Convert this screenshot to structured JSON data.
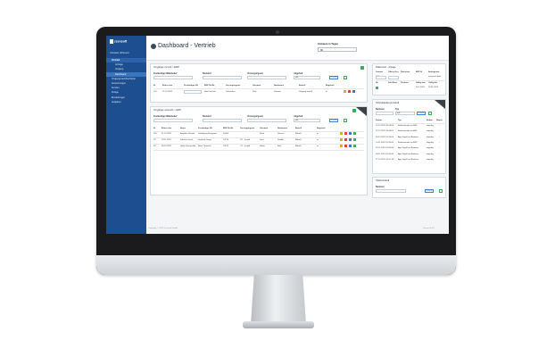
{
  "window": {
    "title": "Dashboard - Vertrieb"
  },
  "brand": {
    "name": "zsensoft",
    "logo_text": "zsensoft"
  },
  "user": {
    "label": "Christian Wittmann"
  },
  "sidebar": {
    "items": [
      {
        "label": "Vertrieb",
        "kind": "section"
      },
      {
        "label": "Anfrage",
        "kind": "sub"
      },
      {
        "label": "Vorgang",
        "kind": "sub"
      },
      {
        "label": "Dashboard",
        "kind": "sub",
        "active": true
      },
      {
        "label": "Vorgangssachbearbeiter",
        "kind": "item"
      },
      {
        "label": "Auswertungen",
        "kind": "item"
      },
      {
        "label": "Kunden",
        "kind": "item"
      },
      {
        "label": "Anlage",
        "kind": "item"
      },
      {
        "label": "Einstellungen",
        "kind": "item"
      },
      {
        "label": "Aufgaben",
        "kind": "item"
      }
    ]
  },
  "header": {
    "zeitraum_label": "Zeitraum in Tagen",
    "zeitraum_value": "30"
  },
  "panel1": {
    "title": "Vorgänge zurück > ERP",
    "filter_labels": [
      "Zuständiger Mitarbeiter",
      "Standort",
      "Vorsorgungsart",
      "Abgeholt"
    ],
    "filter_value": "alle",
    "filter_button": "Filtern",
    "columns": [
      "ID",
      "Erfasst am",
      "Zuständiger Mi.",
      "ERP-Nr./Nr.",
      "Vorsorgungsart",
      "Vorname",
      "Nachname",
      "Betreff",
      "Abgeholt"
    ],
    "rows": [
      [
        "170",
        "21.12.2022",
        "Ident Sachen",
        "Verkäufern",
        "Klee",
        "Schmitz",
        "Vorgang betreff",
        "ja"
      ]
    ]
  },
  "panel2": {
    "title": "Vorgänge versucht > ERP",
    "filter_labels": [
      "Zuständiger Mitarbeiter",
      "Standort",
      "Vorsorgungsart",
      "Abgeholt"
    ],
    "filter_value": "alle",
    "filter_button": "Filtern",
    "columns": [
      "ID",
      "Erfasst am",
      "Name",
      "Zuständiger Mi.",
      "ERP-Nr./Nr.",
      "Vorsorgungsart",
      "Vorname",
      "Nachname",
      "Betreff",
      "Abgeholt"
    ],
    "rows": [
      [
        "165",
        "21.12.2022",
        "Angelika Schmitt",
        "Vorfolgung Entegritter",
        "10455",
        "",
        "Karin",
        "Giersen",
        "Betreff",
        "ja"
      ],
      [
        "79",
        "19.11.2022",
        "Sabrina Jacob",
        "Stephan Lange",
        "14774",
        "CF - Installt",
        "Jens",
        "Stoffels",
        "Betreff",
        "ja"
      ],
      [
        "63",
        "08.12.2022",
        "Heike Sonnenfeld",
        "Rene Tonnelier",
        "13272",
        "OT - Installt",
        "Halter",
        "Bird",
        "Betreff",
        "ja"
      ]
    ]
  },
  "right_panel1": {
    "title": "Datensatz - Anlage",
    "columns": [
      "Gesamt",
      "Offene Ges.",
      "Datensatz",
      "ERP Id",
      "Anfragenart"
    ],
    "values": [
      "TSB",
      "",
      "",
      "",
      "ausgezeichnet"
    ],
    "columns2": [
      "Nr.",
      "Zeitl Best",
      "Zustand",
      "Gültig von",
      "Gültig bis"
    ],
    "values2": [
      "",
      "",
      "",
      "16.1.2023",
      "19.01.2023"
    ]
  },
  "right_panel2": {
    "title": "Schnittstellenprotokoll",
    "filter_labels": [
      "Nummer",
      "Typ"
    ],
    "filter_value": "alle",
    "filter_button": "Filtern",
    "columns": [
      "Datum",
      "Typ",
      "Aktion",
      "Status"
    ],
    "rows": [
      [
        "22.12.2022 10:08:03",
        "Bodenwunder an ERP",
        "abgeltig"
      ],
      [
        "22.12.2022 10:08:03",
        "Bodenwunder an ERP",
        "abgeltig"
      ],
      [
        "08.12.2022 10:36:03",
        "App Zugriff auf Bodenw.",
        "abgeltig"
      ],
      [
        "14.11.2022 10:33:06",
        "Bodenwunder an ERP",
        "abgeltig"
      ],
      [
        "13.11.2022 10:33:06",
        "App Zugriff auf Bodenw.",
        "abgeltig"
      ],
      [
        "08.11.2022 10:33:06",
        "App Zugriff auf Bodenw.",
        "abgeltig"
      ],
      [
        "27.10.2022 10:01:13",
        "App Zugriff auf Bodenw.",
        "abgeltig"
      ]
    ]
  },
  "right_panel3": {
    "title": "Statprotokoll",
    "filter_label": "Nummer",
    "filter_button": "Filtern"
  },
  "footer": {
    "copyright": "Copyright © 2022 Zsensoft GmbH",
    "version": "Version 0.0.6"
  },
  "colors": {
    "sidebar": "#1d4e8f",
    "accent": "#3b82d8",
    "success": "#3daa57",
    "warning": "#f0a318",
    "danger": "#d9443a"
  }
}
